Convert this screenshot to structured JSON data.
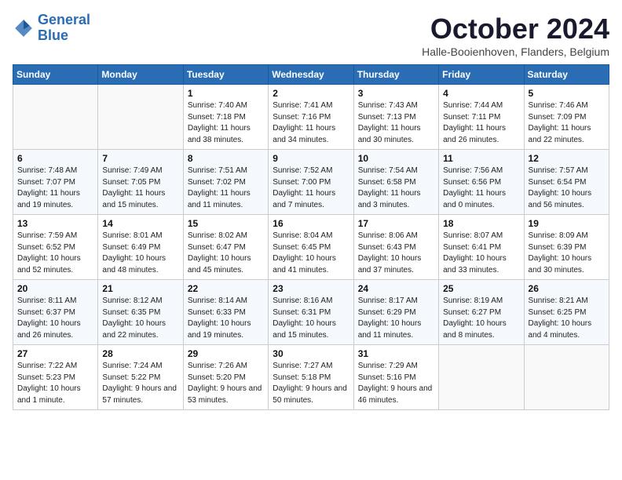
{
  "header": {
    "logo_line1": "General",
    "logo_line2": "Blue",
    "month_title": "October 2024",
    "location": "Halle-Booienhoven, Flanders, Belgium"
  },
  "weekdays": [
    "Sunday",
    "Monday",
    "Tuesday",
    "Wednesday",
    "Thursday",
    "Friday",
    "Saturday"
  ],
  "weeks": [
    [
      {
        "day": "",
        "info": ""
      },
      {
        "day": "",
        "info": ""
      },
      {
        "day": "1",
        "info": "Sunrise: 7:40 AM\nSunset: 7:18 PM\nDaylight: 11 hours and 38 minutes."
      },
      {
        "day": "2",
        "info": "Sunrise: 7:41 AM\nSunset: 7:16 PM\nDaylight: 11 hours and 34 minutes."
      },
      {
        "day": "3",
        "info": "Sunrise: 7:43 AM\nSunset: 7:13 PM\nDaylight: 11 hours and 30 minutes."
      },
      {
        "day": "4",
        "info": "Sunrise: 7:44 AM\nSunset: 7:11 PM\nDaylight: 11 hours and 26 minutes."
      },
      {
        "day": "5",
        "info": "Sunrise: 7:46 AM\nSunset: 7:09 PM\nDaylight: 11 hours and 22 minutes."
      }
    ],
    [
      {
        "day": "6",
        "info": "Sunrise: 7:48 AM\nSunset: 7:07 PM\nDaylight: 11 hours and 19 minutes."
      },
      {
        "day": "7",
        "info": "Sunrise: 7:49 AM\nSunset: 7:05 PM\nDaylight: 11 hours and 15 minutes."
      },
      {
        "day": "8",
        "info": "Sunrise: 7:51 AM\nSunset: 7:02 PM\nDaylight: 11 hours and 11 minutes."
      },
      {
        "day": "9",
        "info": "Sunrise: 7:52 AM\nSunset: 7:00 PM\nDaylight: 11 hours and 7 minutes."
      },
      {
        "day": "10",
        "info": "Sunrise: 7:54 AM\nSunset: 6:58 PM\nDaylight: 11 hours and 3 minutes."
      },
      {
        "day": "11",
        "info": "Sunrise: 7:56 AM\nSunset: 6:56 PM\nDaylight: 11 hours and 0 minutes."
      },
      {
        "day": "12",
        "info": "Sunrise: 7:57 AM\nSunset: 6:54 PM\nDaylight: 10 hours and 56 minutes."
      }
    ],
    [
      {
        "day": "13",
        "info": "Sunrise: 7:59 AM\nSunset: 6:52 PM\nDaylight: 10 hours and 52 minutes."
      },
      {
        "day": "14",
        "info": "Sunrise: 8:01 AM\nSunset: 6:49 PM\nDaylight: 10 hours and 48 minutes."
      },
      {
        "day": "15",
        "info": "Sunrise: 8:02 AM\nSunset: 6:47 PM\nDaylight: 10 hours and 45 minutes."
      },
      {
        "day": "16",
        "info": "Sunrise: 8:04 AM\nSunset: 6:45 PM\nDaylight: 10 hours and 41 minutes."
      },
      {
        "day": "17",
        "info": "Sunrise: 8:06 AM\nSunset: 6:43 PM\nDaylight: 10 hours and 37 minutes."
      },
      {
        "day": "18",
        "info": "Sunrise: 8:07 AM\nSunset: 6:41 PM\nDaylight: 10 hours and 33 minutes."
      },
      {
        "day": "19",
        "info": "Sunrise: 8:09 AM\nSunset: 6:39 PM\nDaylight: 10 hours and 30 minutes."
      }
    ],
    [
      {
        "day": "20",
        "info": "Sunrise: 8:11 AM\nSunset: 6:37 PM\nDaylight: 10 hours and 26 minutes."
      },
      {
        "day": "21",
        "info": "Sunrise: 8:12 AM\nSunset: 6:35 PM\nDaylight: 10 hours and 22 minutes."
      },
      {
        "day": "22",
        "info": "Sunrise: 8:14 AM\nSunset: 6:33 PM\nDaylight: 10 hours and 19 minutes."
      },
      {
        "day": "23",
        "info": "Sunrise: 8:16 AM\nSunset: 6:31 PM\nDaylight: 10 hours and 15 minutes."
      },
      {
        "day": "24",
        "info": "Sunrise: 8:17 AM\nSunset: 6:29 PM\nDaylight: 10 hours and 11 minutes."
      },
      {
        "day": "25",
        "info": "Sunrise: 8:19 AM\nSunset: 6:27 PM\nDaylight: 10 hours and 8 minutes."
      },
      {
        "day": "26",
        "info": "Sunrise: 8:21 AM\nSunset: 6:25 PM\nDaylight: 10 hours and 4 minutes."
      }
    ],
    [
      {
        "day": "27",
        "info": "Sunrise: 7:22 AM\nSunset: 5:23 PM\nDaylight: 10 hours and 1 minute."
      },
      {
        "day": "28",
        "info": "Sunrise: 7:24 AM\nSunset: 5:22 PM\nDaylight: 9 hours and 57 minutes."
      },
      {
        "day": "29",
        "info": "Sunrise: 7:26 AM\nSunset: 5:20 PM\nDaylight: 9 hours and 53 minutes."
      },
      {
        "day": "30",
        "info": "Sunrise: 7:27 AM\nSunset: 5:18 PM\nDaylight: 9 hours and 50 minutes."
      },
      {
        "day": "31",
        "info": "Sunrise: 7:29 AM\nSunset: 5:16 PM\nDaylight: 9 hours and 46 minutes."
      },
      {
        "day": "",
        "info": ""
      },
      {
        "day": "",
        "info": ""
      }
    ]
  ]
}
